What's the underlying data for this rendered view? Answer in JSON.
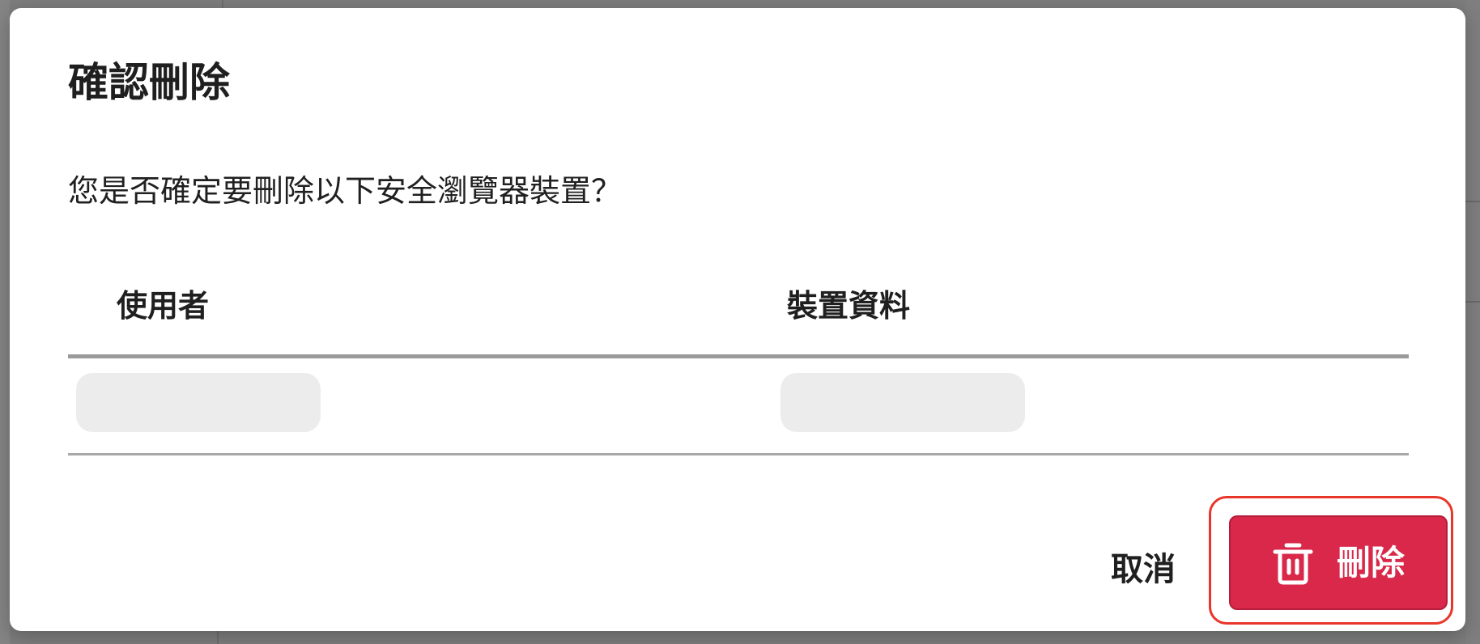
{
  "dialog": {
    "title": "確認刪除",
    "message": "您是否確定要刪除以下安全瀏覽器裝置？"
  },
  "table": {
    "columns": [
      "使用者",
      "裝置資料"
    ]
  },
  "actions": {
    "cancel_label": "取消",
    "delete_label": "刪除",
    "delete_icon": "trash-icon"
  },
  "colors": {
    "delete_button": "#d9284a",
    "focus_ring": "#e8362a",
    "overlay": "#7d7d7d"
  }
}
